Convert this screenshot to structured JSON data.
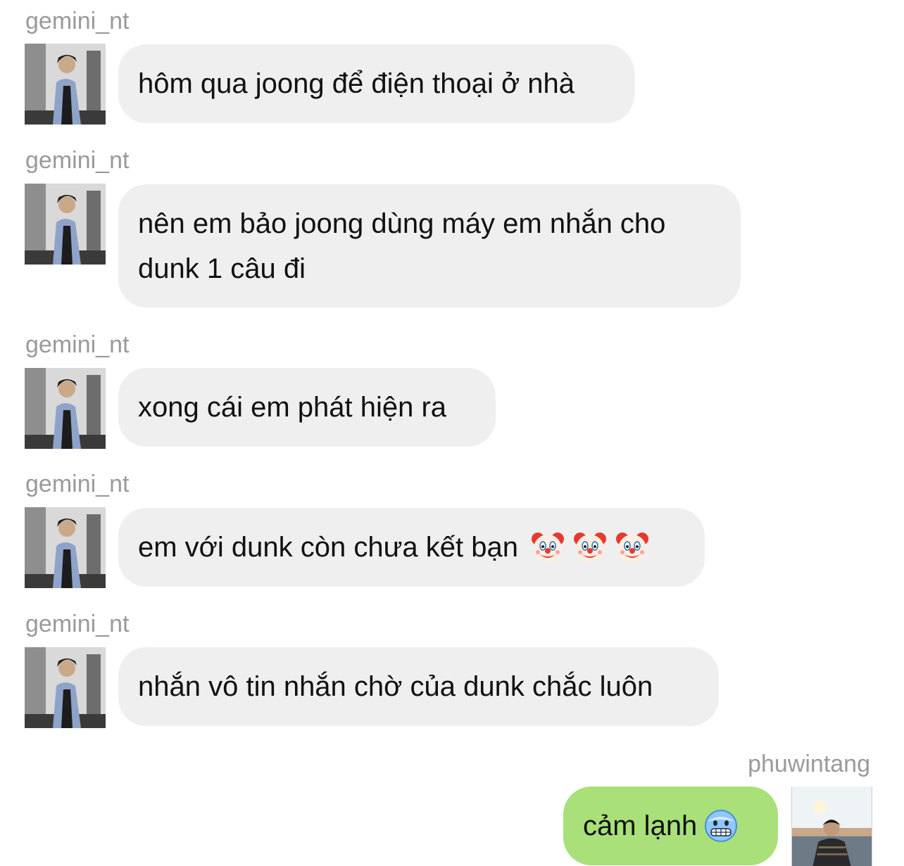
{
  "messages": [
    {
      "sender": "gemini_nt",
      "text": "hôm qua joong để điện thoại ở nhà",
      "emoji": []
    },
    {
      "sender": "gemini_nt",
      "text": "nên em bảo joong dùng máy em nhắn cho dunk 1 câu đi",
      "emoji": []
    },
    {
      "sender": "gemini_nt",
      "text": "xong cái em phát hiện ra",
      "emoji": []
    },
    {
      "sender": "gemini_nt",
      "text": "em với dunk còn chưa kết bạn",
      "emoji": [
        "clown-face-icon",
        "clown-face-icon",
        "clown-face-icon"
      ]
    },
    {
      "sender": "gemini_nt",
      "text": "nhắn vô tin nhắn chờ của dunk chắc luôn",
      "emoji": []
    },
    {
      "sender": "phuwintang",
      "text": "cảm lạnh",
      "emoji": [
        "cold-face-icon"
      ]
    }
  ],
  "colors": {
    "incoming_bubble": "#efefef",
    "outgoing_bubble": "#a9e07a",
    "username": "#9a9a9a",
    "text": "#111111"
  }
}
